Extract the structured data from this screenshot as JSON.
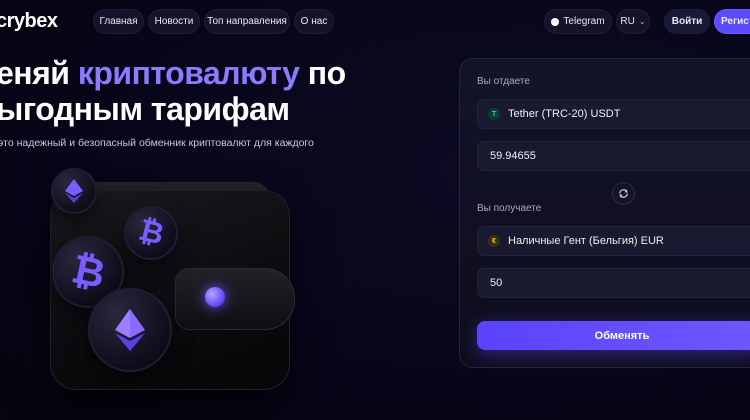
{
  "header": {
    "logo": "crybex",
    "nav": [
      "Главная",
      "Новости",
      "Топ направления",
      "О нас"
    ],
    "telegram": "Telegram",
    "lang": "RU",
    "login": "Войти",
    "register": "Регистр"
  },
  "hero": {
    "title_part1": "еняй ",
    "title_accent": "криптовалюту",
    "title_part2": " по",
    "title_line2": "ыгодным тарифам",
    "subtitle": "это надежный и безопасный обменник криптовалют для каждого"
  },
  "exchange": {
    "give_label": "Вы отдаете",
    "give_currency": "Tether (TRC-20) USDT",
    "give_amount": "59.94655",
    "get_label": "Вы получаете",
    "get_currency": "Наличные Гент (Бельгия) EUR",
    "get_amount": "50",
    "submit": "Обменять"
  },
  "colors": {
    "accent": "#8d7bff",
    "button": "#5b4bff"
  },
  "icons": [
    "telegram-icon",
    "chevron-down-icon",
    "swap-icon",
    "tether-icon",
    "euro-icon",
    "bitcoin-icon",
    "ethereum-icon"
  ]
}
